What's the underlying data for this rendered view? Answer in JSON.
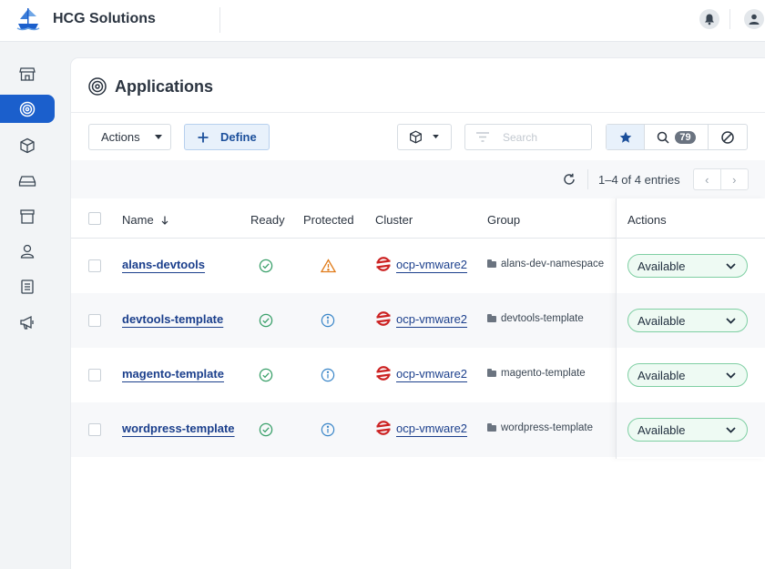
{
  "header": {
    "brand": "HCG Solutions"
  },
  "sidebar": {
    "items": [
      {
        "icon": "store-icon"
      },
      {
        "icon": "applications-icon",
        "active": true
      },
      {
        "icon": "cube-icon"
      },
      {
        "icon": "storage-icon"
      },
      {
        "icon": "archive-icon"
      },
      {
        "icon": "user-icon"
      },
      {
        "icon": "document-list-icon"
      },
      {
        "icon": "megaphone-icon"
      }
    ]
  },
  "page": {
    "title": "Applications"
  },
  "toolbar": {
    "actions_label": "Actions",
    "define_label": "Define",
    "search_placeholder": "Search",
    "count_badge": "79"
  },
  "pagination": {
    "entries": "1–4 of 4 entries"
  },
  "table": {
    "headers": {
      "name": "Name",
      "ready": "Ready",
      "protected": "Protected",
      "cluster": "Cluster",
      "group": "Group",
      "actions": "Actions"
    },
    "rows": [
      {
        "name": "alans-devtools",
        "ready": "check",
        "protected": "warning",
        "cluster": "ocp-vmware2",
        "group": "alans-dev-namespace",
        "status": "Available"
      },
      {
        "name": "devtools-template",
        "ready": "check",
        "protected": "info",
        "cluster": "ocp-vmware2",
        "group": "devtools-template",
        "status": "Available"
      },
      {
        "name": "magento-template",
        "ready": "check",
        "protected": "info",
        "cluster": "ocp-vmware2",
        "group": "magento-template",
        "status": "Available"
      },
      {
        "name": "wordpress-template",
        "ready": "check",
        "protected": "info",
        "cluster": "ocp-vmware2",
        "group": "wordpress-template",
        "status": "Available"
      }
    ]
  },
  "colors": {
    "accent": "#1b5fcc",
    "link": "#1b3f8c",
    "success": "#3aa06a",
    "warning": "#e07b1a",
    "info": "#3a86c8",
    "openshift": "#cc2222"
  }
}
